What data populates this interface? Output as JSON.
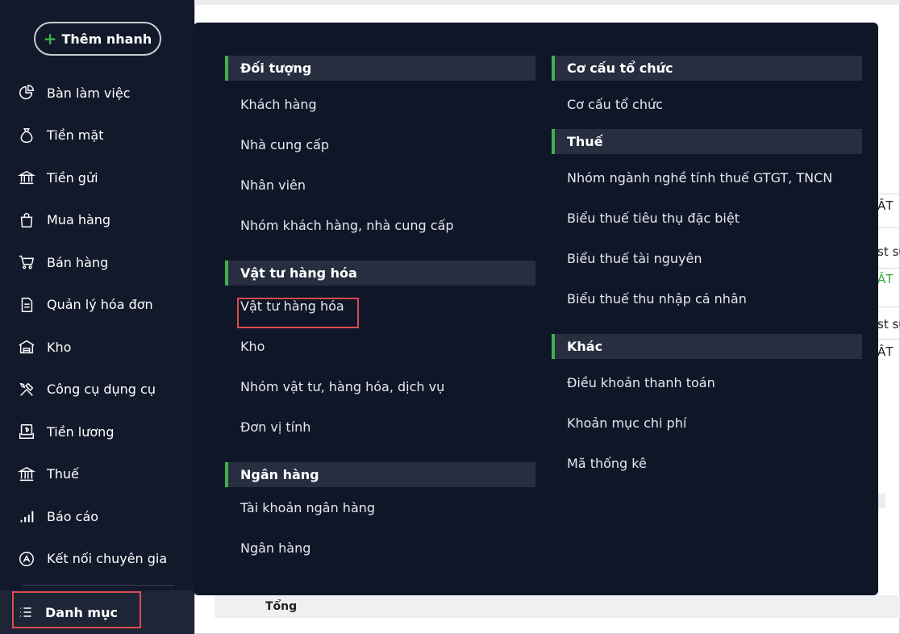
{
  "sidebar": {
    "quick_add": "Thêm nhanh",
    "items": [
      {
        "label": "Bàn làm việc",
        "icon": "dashboard-icon"
      },
      {
        "label": "Tiền mặt",
        "icon": "money-bag-icon"
      },
      {
        "label": "Tiền gửi",
        "icon": "bank-icon"
      },
      {
        "label": "Mua hàng",
        "icon": "shopping-bag-icon"
      },
      {
        "label": "Bán hàng",
        "icon": "cart-icon"
      },
      {
        "label": "Quản lý hóa đơn",
        "icon": "invoice-icon"
      },
      {
        "label": "Kho",
        "icon": "warehouse-icon"
      },
      {
        "label": "Công cụ dụng cụ",
        "icon": "tools-icon"
      },
      {
        "label": "Tiền lương",
        "icon": "salary-icon"
      },
      {
        "label": "Thuế",
        "icon": "tax-icon"
      },
      {
        "label": "Báo cáo",
        "icon": "report-icon"
      },
      {
        "label": "Kết nối chuyên gia",
        "icon": "expert-icon"
      }
    ],
    "catalog": "Danh mục"
  },
  "menu": {
    "left": [
      {
        "header": "Đối tượng",
        "items": [
          "Khách hàng",
          "Nhà cung cấp",
          "Nhân viên",
          "Nhóm khách hàng, nhà cung cấp"
        ]
      },
      {
        "header": "Vật tư hàng hóa",
        "items": [
          "Vật tư hàng hóa",
          "Kho",
          "Nhóm vật tư, hàng hóa, dịch vụ",
          "Đơn vị tính"
        ]
      },
      {
        "header": "Ngân hàng",
        "items": [
          "Tài khoản ngân hàng",
          "Ngân hàng"
        ]
      }
    ],
    "right": [
      {
        "header": "Cơ cấu tổ chức",
        "items": [
          "Cơ cấu tổ chức"
        ]
      },
      {
        "header": "Thuế",
        "items": [
          "Nhóm ngành nghề tính thuế GTGT, TNCN",
          "Biểu thuế tiêu thụ đặc biệt",
          "Biểu thuế tài nguyên",
          "Biểu thuế thu nhập cá nhân"
        ]
      },
      {
        "header": "Khác",
        "items": [
          "Điều khoản thanh toán",
          "Khoản mục chi phí",
          "Mã thống kê"
        ]
      }
    ]
  },
  "background": {
    "cells": [
      "ẤT",
      "st sử",
      "ẤT",
      "st sử",
      "ẤT"
    ],
    "total": "Tổng"
  },
  "colors": {
    "accent": "#3fb14b",
    "highlight": "#e04a4f",
    "sidebar": "#12192a",
    "panel": "#0f1628"
  }
}
